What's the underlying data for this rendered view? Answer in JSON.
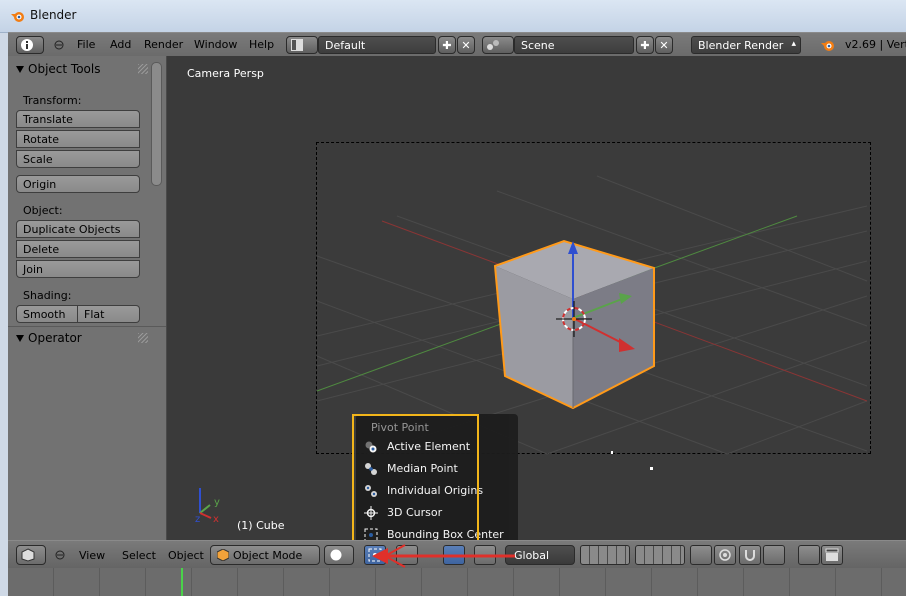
{
  "window": {
    "title": "Blender"
  },
  "top_header": {
    "menus": [
      "File",
      "Add",
      "Render",
      "Window",
      "Help"
    ],
    "screen_layout": "Default",
    "scene": "Scene",
    "render_engine": "Blender Render",
    "version": "v2.69 | Vert"
  },
  "tool_shelf": {
    "panel_title": "Object Tools",
    "transform_label": "Transform:",
    "transform_buttons": [
      "Translate",
      "Rotate",
      "Scale"
    ],
    "origin_button": "Origin",
    "object_label": "Object:",
    "object_buttons": [
      "Duplicate Objects",
      "Delete",
      "Join"
    ],
    "shading_label": "Shading:",
    "shading_buttons": [
      "Smooth",
      "Flat"
    ],
    "operator_title": "Operator"
  },
  "viewport": {
    "view_label": "Camera Persp",
    "object_label": "(1) Cube",
    "axis_labels": {
      "x": "x",
      "y": "y",
      "z": "z"
    }
  },
  "pivot_menu": {
    "title": "Pivot Point",
    "items": [
      "Active Element",
      "Median Point",
      "Individual Origins",
      "3D Cursor",
      "Bounding Box Center"
    ]
  },
  "bottom_header": {
    "menus": [
      "View",
      "Select",
      "Object"
    ],
    "mode": "Object Mode",
    "orientation": "Global"
  },
  "colors": {
    "highlight_box": "#f2b51a",
    "selection_outline": "#ff9a1a",
    "annotation_arrow": "#e0302a",
    "x_axis": "#b03a3a",
    "y_axis": "#5aa34a",
    "z_axis": "#2f4fd0"
  }
}
